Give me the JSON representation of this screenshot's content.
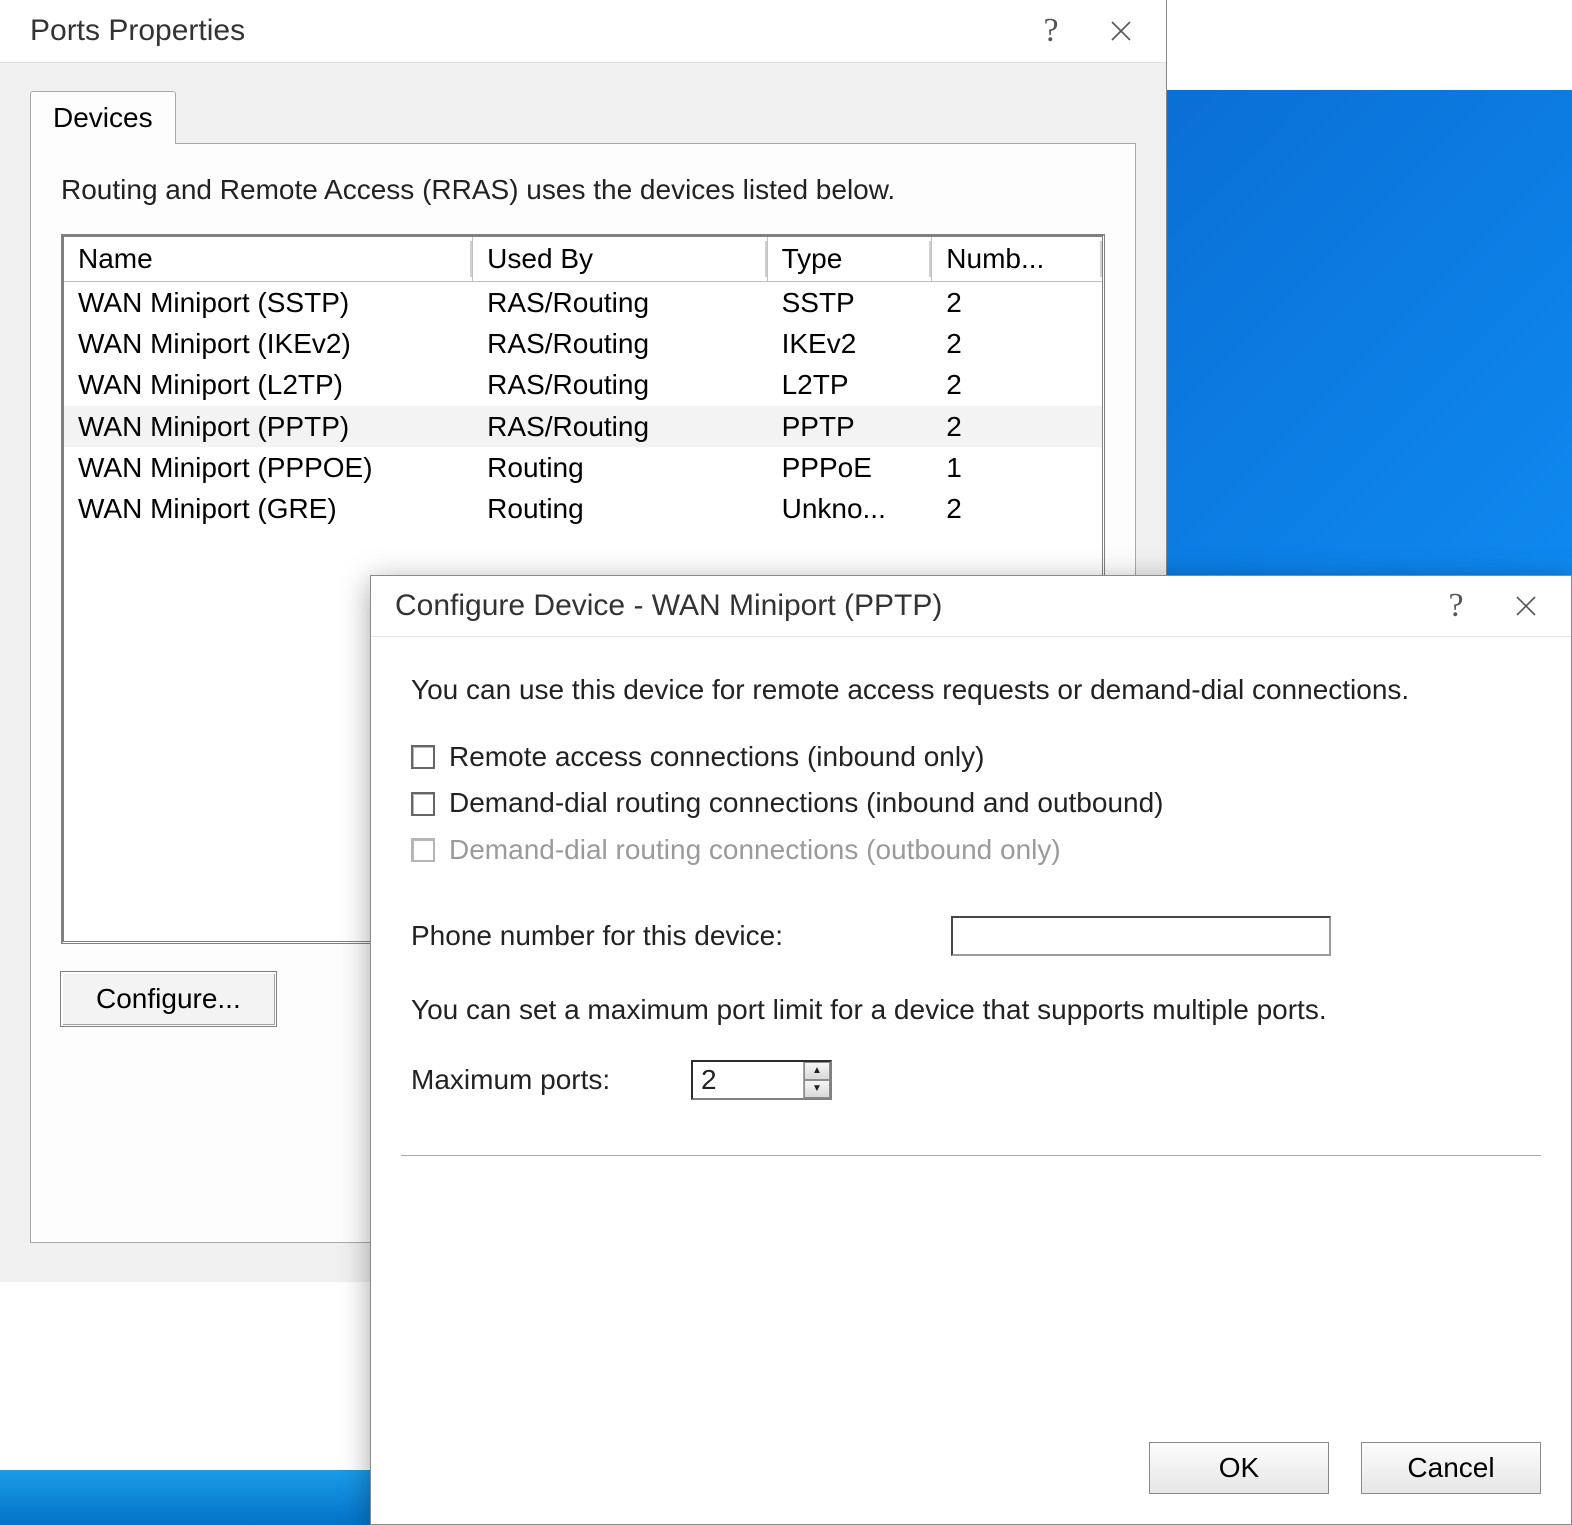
{
  "ports_dialog": {
    "title": "Ports Properties",
    "tab_label": "Devices",
    "description": "Routing and Remote Access (RRAS) uses the devices listed below.",
    "columns": {
      "name": "Name",
      "used_by": "Used By",
      "type": "Type",
      "num": "Numb..."
    },
    "devices": [
      {
        "name": "WAN Miniport (SSTP)",
        "used_by": "RAS/Routing",
        "type": "SSTP",
        "num": "2",
        "selected": false
      },
      {
        "name": "WAN Miniport (IKEv2)",
        "used_by": "RAS/Routing",
        "type": "IKEv2",
        "num": "2",
        "selected": false
      },
      {
        "name": "WAN Miniport (L2TP)",
        "used_by": "RAS/Routing",
        "type": "L2TP",
        "num": "2",
        "selected": false
      },
      {
        "name": "WAN Miniport (PPTP)",
        "used_by": "RAS/Routing",
        "type": "PPTP",
        "num": "2",
        "selected": true
      },
      {
        "name": "WAN Miniport (PPPOE)",
        "used_by": "Routing",
        "type": "PPPoE",
        "num": "1",
        "selected": false
      },
      {
        "name": "WAN Miniport (GRE)",
        "used_by": "Routing",
        "type": "Unkno...",
        "num": "2",
        "selected": false
      }
    ],
    "configure_button": "Configure..."
  },
  "configure_dialog": {
    "title": "Configure Device - WAN Miniport (PPTP)",
    "description": "You can use this device for remote access requests or demand-dial connections.",
    "options": {
      "remote_access": "Remote access connections (inbound only)",
      "demand_inout": "Demand-dial routing connections (inbound and outbound)",
      "demand_out": "Demand-dial routing connections (outbound only)"
    },
    "phone_label": "Phone number for this device:",
    "phone_value": "",
    "note": "You can set a maximum port limit for a device that supports multiple ports.",
    "max_label": "Maximum ports:",
    "max_value": "2",
    "ok_label": "OK",
    "cancel_label": "Cancel"
  },
  "help_glyph": "?",
  "spin_up": "▲",
  "spin_down": "▼"
}
